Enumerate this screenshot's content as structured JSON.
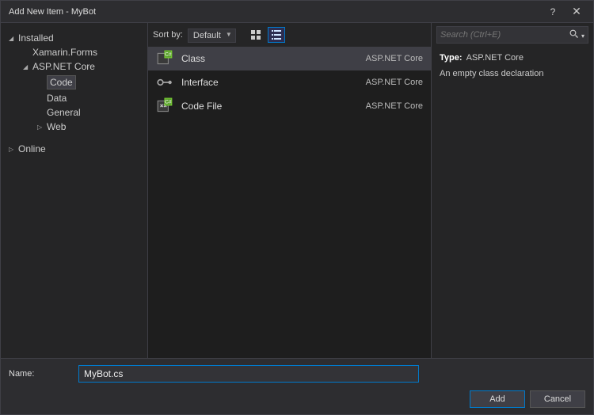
{
  "window": {
    "title": "Add New Item - MyBot",
    "help_icon": "?",
    "close_icon": "✕"
  },
  "sidebar": {
    "installed_label": "Installed",
    "items": [
      {
        "label": "Xamarin.Forms",
        "level": 2,
        "arrow": ""
      },
      {
        "label": "ASP.NET Core",
        "level": 2,
        "arrow": "◢"
      },
      {
        "label": "Code",
        "level": 3,
        "arrow": "",
        "selected": true
      },
      {
        "label": "Data",
        "level": 3,
        "arrow": ""
      },
      {
        "label": "General",
        "level": 3,
        "arrow": ""
      },
      {
        "label": "Web",
        "level": 3,
        "arrow": "▷"
      }
    ],
    "online_label": "Online"
  },
  "toolbar": {
    "sort_label": "Sort by:",
    "sort_value": "Default"
  },
  "templates": [
    {
      "name": "Class",
      "group": "ASP.NET Core",
      "selected": true,
      "icon": "class"
    },
    {
      "name": "Interface",
      "group": "ASP.NET Core",
      "selected": false,
      "icon": "interface"
    },
    {
      "name": "Code File",
      "group": "ASP.NET Core",
      "selected": false,
      "icon": "codefile"
    }
  ],
  "search": {
    "placeholder": "Search (Ctrl+E)"
  },
  "details": {
    "type_label": "Type:",
    "type_value": "ASP.NET Core",
    "description": "An empty class declaration"
  },
  "footer": {
    "name_label": "Name:",
    "name_value": "MyBot.cs",
    "add_label": "Add",
    "cancel_label": "Cancel"
  }
}
